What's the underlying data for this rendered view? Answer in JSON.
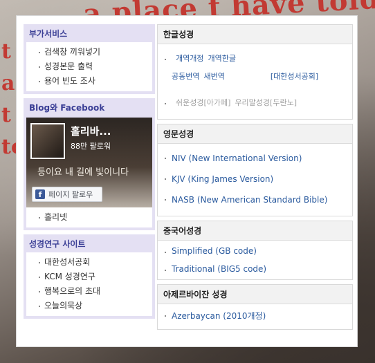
{
  "background": {
    "text_line1": "a place f  have told",
    "text_line2": "t a t  to"
  },
  "extra_services": {
    "title": "부가서비스",
    "items": [
      "검색창 끼워넣기",
      "성경본문 출력",
      "용어 빈도 조사"
    ]
  },
  "blog_facebook": {
    "title": "Blog와 Facebook",
    "page_name": "홀리바...",
    "followers": "88만 팔로워",
    "verse_text": "등이요 내 길에 빛이니다",
    "follow_label": "페이지 팔로우",
    "follow_icon": "f",
    "links": [
      "홀리넷"
    ]
  },
  "research": {
    "title": "성경연구 사이트",
    "items": [
      "대한성서공회",
      "KCM 성경연구",
      "행복으로의 초대",
      "오늘의묵상"
    ]
  },
  "korean": {
    "title": "한글성경",
    "row1": [
      "개역개정",
      "개역한글"
    ],
    "row2": [
      "공동번역",
      "새번역",
      "[대한성서공회]"
    ],
    "row3": [
      "쉬운성경[아가페]",
      "우리말성경[두란노]"
    ]
  },
  "english": {
    "title": "영문성경",
    "items": [
      "NIV (New International Version)",
      "KJV (King James Version)",
      "NASB (New American Standard Bible)"
    ]
  },
  "chinese": {
    "title": "중국어성경",
    "items": [
      "Simplified (GB code)",
      "Traditional (BIG5 code)"
    ]
  },
  "azerbaijani": {
    "title": "아제르바이잔 성경",
    "items": [
      "Azerbaycan (2010개정)"
    ]
  }
}
